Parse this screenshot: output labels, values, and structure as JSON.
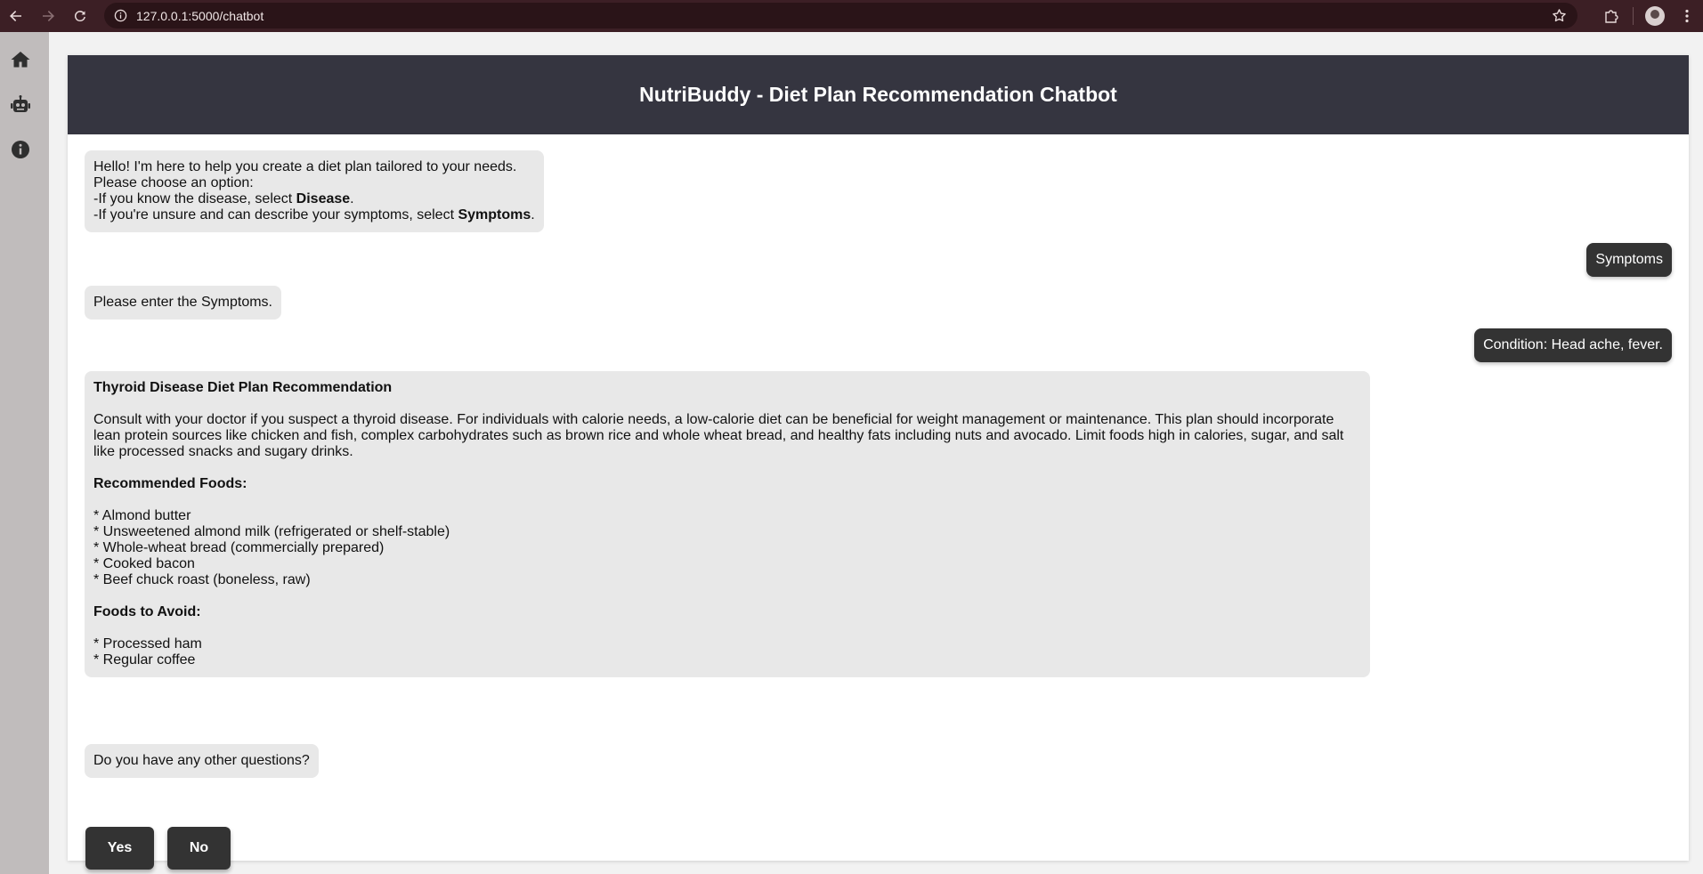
{
  "browser": {
    "url": "127.0.0.1:5000/chatbot"
  },
  "sidebar": {
    "items": [
      {
        "icon": "home-icon"
      },
      {
        "icon": "robot-icon"
      },
      {
        "icon": "info-icon"
      }
    ]
  },
  "header": {
    "title": "NutriBuddy - Diet Plan Recommendation Chatbot"
  },
  "chat": {
    "greeting": {
      "line1": "Hello! I'm here to help you create a diet plan tailored to your needs.",
      "line2": "Please choose an option:",
      "line3_prefix": "-If you know the disease, select ",
      "line3_bold": "Disease",
      "line3_suffix": ".",
      "line4_prefix": "-If you're unsure and can describe your symptoms, select ",
      "line4_bold": "Symptoms",
      "line4_suffix": "."
    },
    "user_choice": "Symptoms",
    "prompt_symptoms": "Please enter the Symptoms.",
    "user_condition": "Condition: Head ache, fever.",
    "recommendation": {
      "title": "Thyroid Disease Diet Plan Recommendation",
      "body": "Consult with your doctor if you suspect a thyroid disease. For individuals with calorie needs, a low-calorie diet can be beneficial for weight management or maintenance. This plan should incorporate lean protein sources like chicken and fish, complex carbohydrates such as brown rice and whole wheat bread, and healthy fats including nuts and avocado. Limit foods high in calories, sugar, and salt like processed snacks and sugary drinks.",
      "recommended_heading": "Recommended Foods:",
      "recommended": [
        "* Almond butter",
        "* Unsweetened almond milk (refrigerated or shelf-stable)",
        "* Whole-wheat bread (commercially prepared)",
        "* Cooked bacon",
        "* Beef chuck roast (boneless, raw)"
      ],
      "avoid_heading": "Foods to Avoid:",
      "avoid": [
        "* Processed ham",
        "* Regular coffee"
      ]
    },
    "followup": "Do you have any other questions?",
    "yes_label": "Yes",
    "no_label": "No"
  },
  "colors": {
    "browser_bar": "#3c1f25",
    "header_bg": "#353540",
    "bot_bubble": "#e8e8e8",
    "user_bubble": "#333333",
    "sidebar_bg": "#c0bcbc"
  }
}
